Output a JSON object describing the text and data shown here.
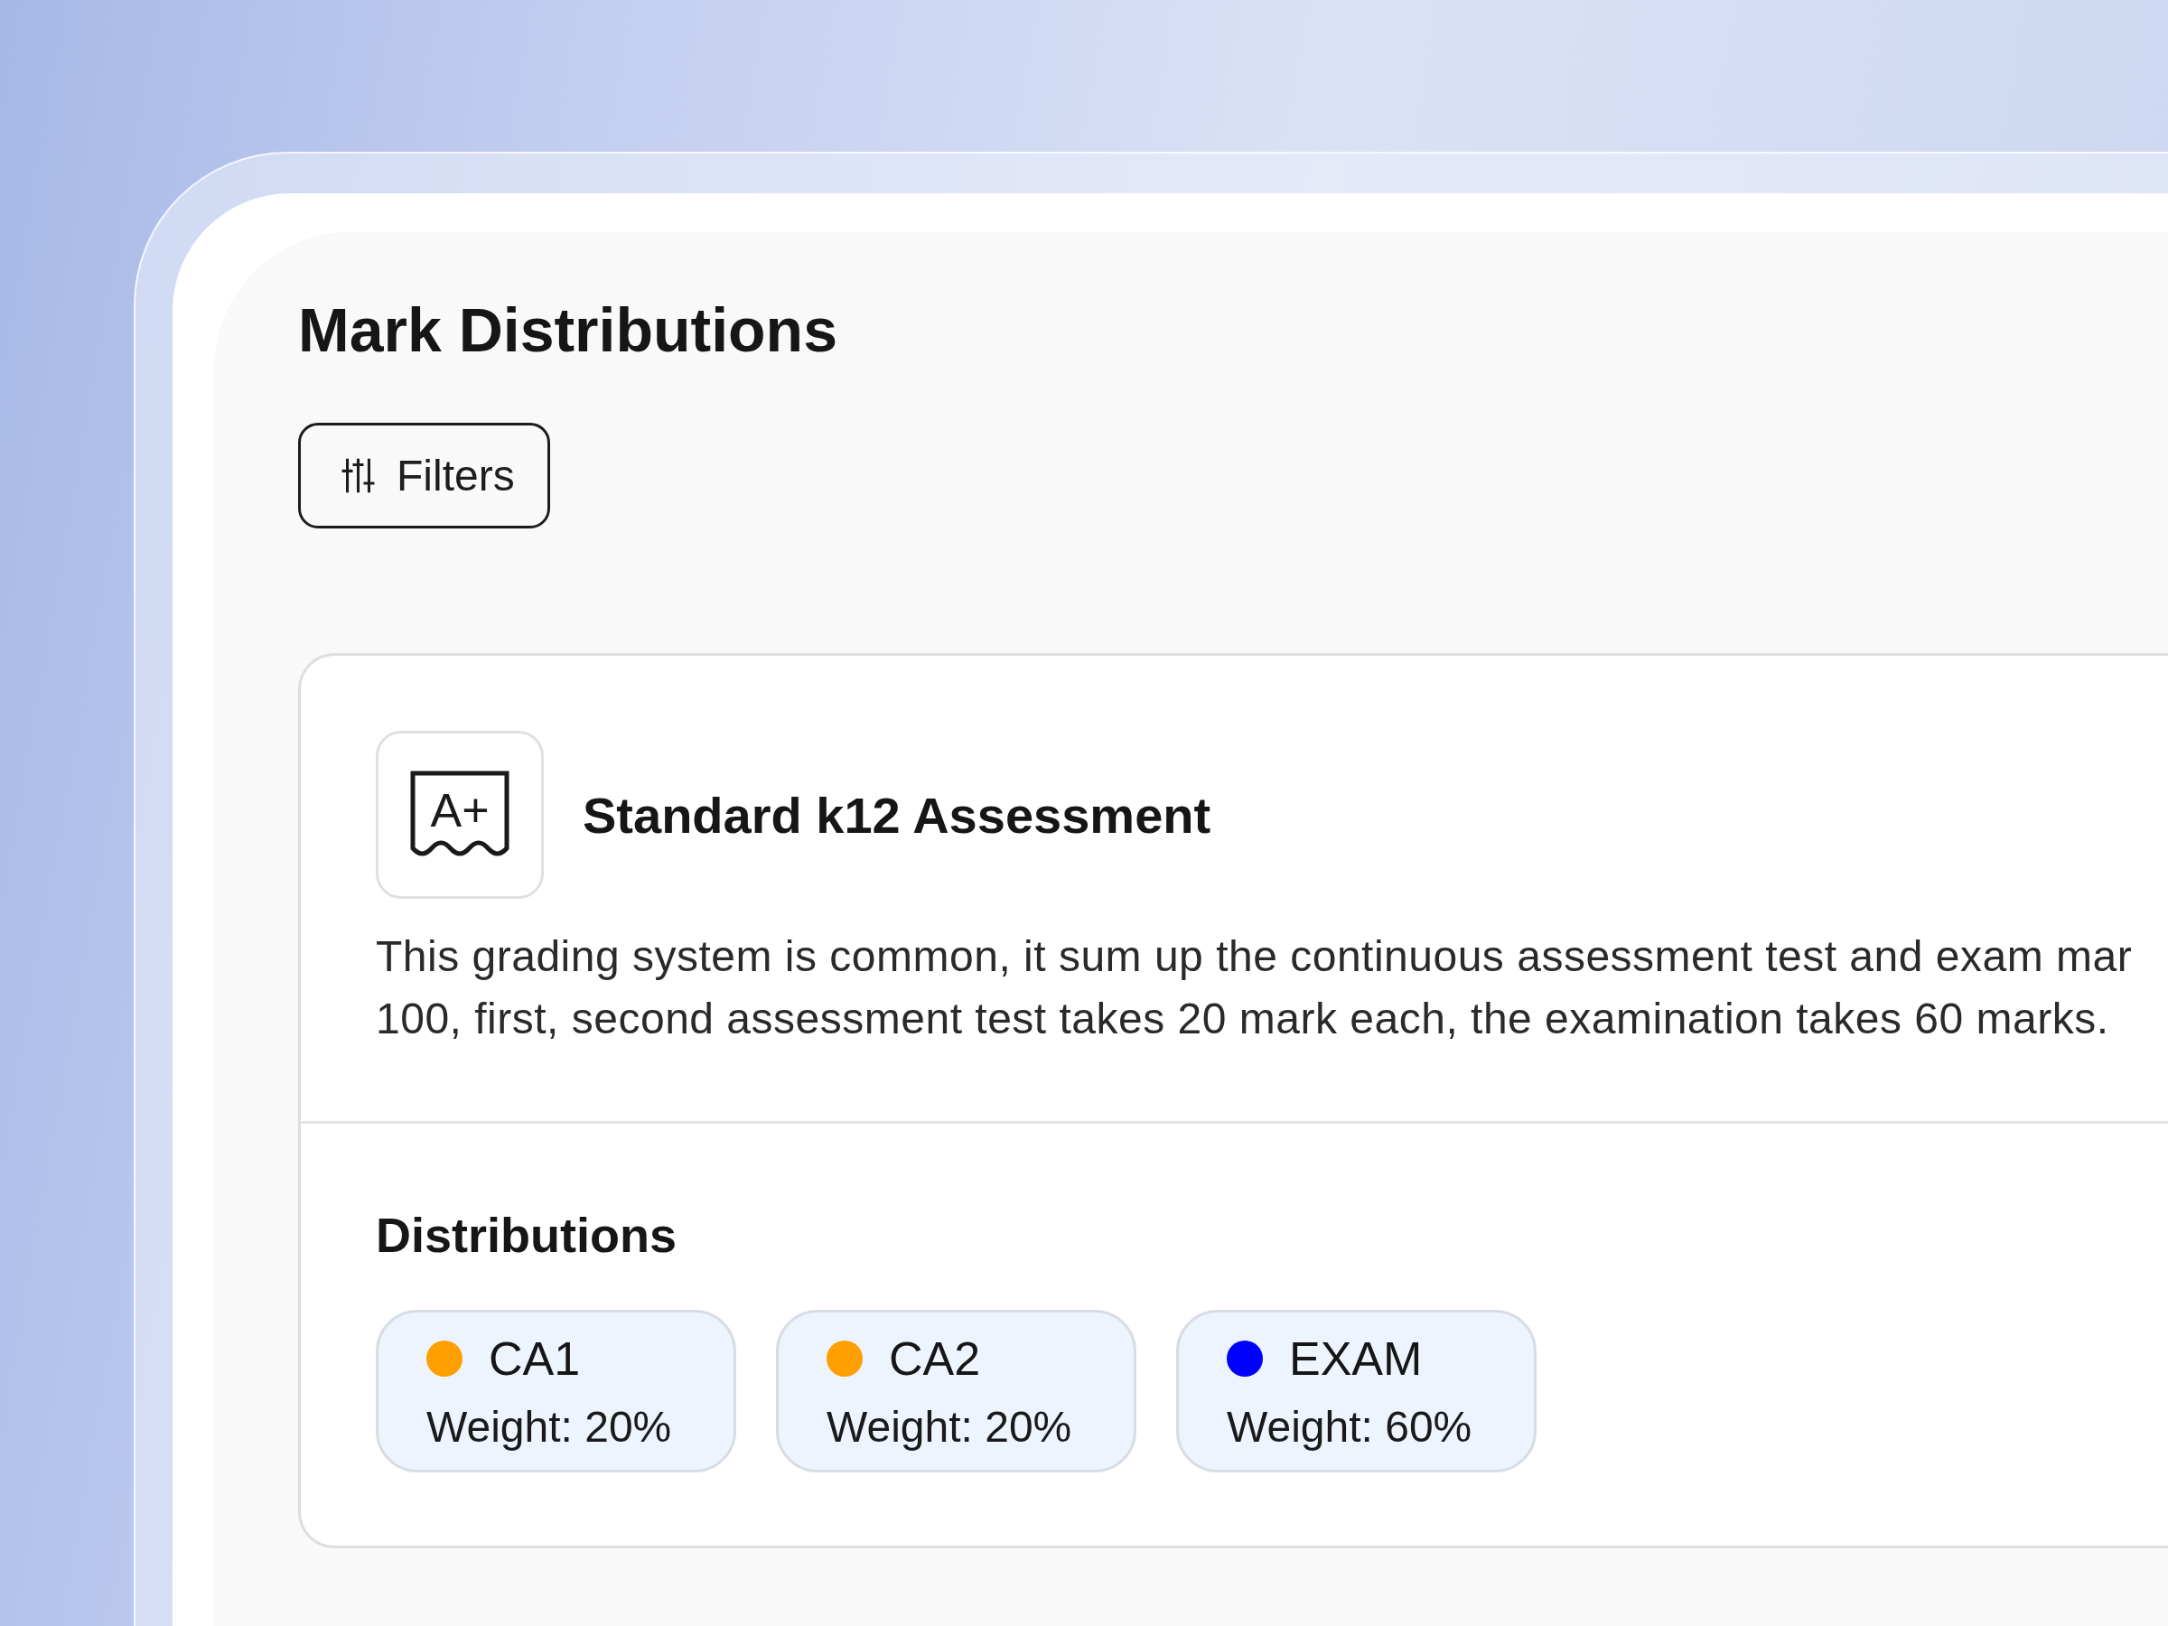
{
  "page_title": "Mark Distributions",
  "filters_button": {
    "label": "Filters"
  },
  "assessment": {
    "icon_label": "A+",
    "title": "Standard k12 Assessment",
    "description_lines": [
      "This grading system is common, it sum up the continuous assessment test and exam mar",
      "100, first, second assessment test takes 20 mark each, the examination takes 60 marks."
    ],
    "distributions": {
      "heading": "Distributions",
      "items": [
        {
          "name": "CA1",
          "weight": "Weight: 20%",
          "color": "#ff9f00"
        },
        {
          "name": "CA2",
          "weight": "Weight: 20%",
          "color": "#ff9f00"
        },
        {
          "name": "EXAM",
          "weight": "Weight: 60%",
          "color": "#0000ff"
        }
      ]
    }
  }
}
